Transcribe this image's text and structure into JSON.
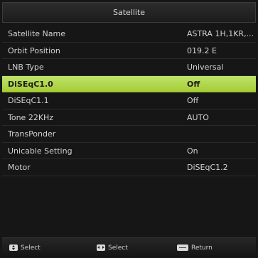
{
  "header": {
    "title": "Satellite"
  },
  "settings": [
    {
      "label": "Satellite Name",
      "value": "ASTRA 1H,1KR,..."
    },
    {
      "label": "Orbit Position",
      "value": "019.2 E"
    },
    {
      "label": "LNB Type",
      "value": "Universal"
    },
    {
      "label": "DiSEqC1.0",
      "value": "Off",
      "selected": true
    },
    {
      "label": "DiSEqC1.1",
      "value": "Off"
    },
    {
      "label": "Tone 22KHz",
      "value": "AUTO"
    },
    {
      "label": "TransPonder",
      "value": ""
    },
    {
      "label": "Unicable Setting",
      "value": "On"
    },
    {
      "label": "Motor",
      "value": "DiSEqC1.2"
    }
  ],
  "footer": {
    "hints": [
      {
        "icon": "up-down-key-icon",
        "label": "Select"
      },
      {
        "icon": "left-right-key-icon",
        "label": "Select"
      },
      {
        "icon": "menu-key-icon",
        "label": "Return"
      }
    ]
  },
  "colors": {
    "selected_bg": "#b2d84a",
    "background": "#161616"
  }
}
